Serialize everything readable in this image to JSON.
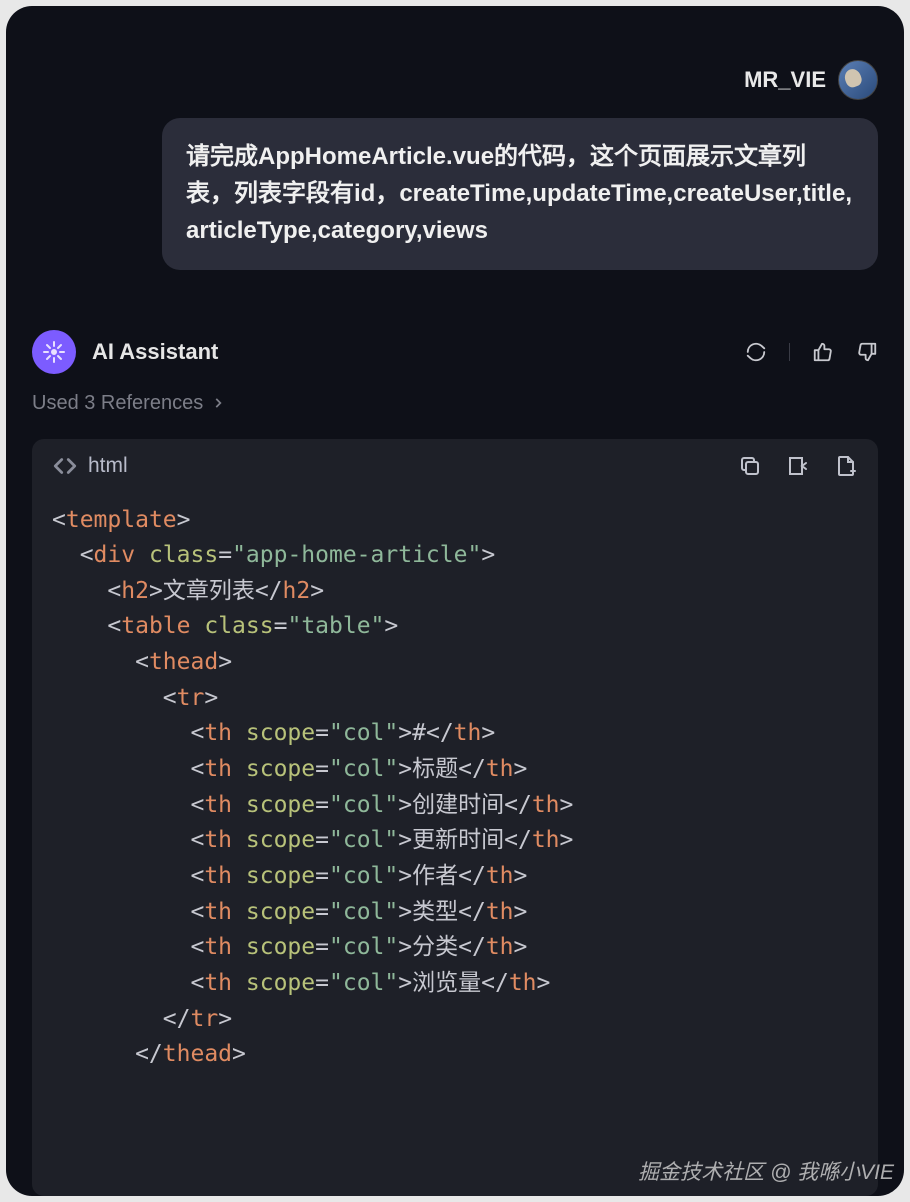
{
  "user": {
    "name": "MR_VIE",
    "message": "请完成AppHomeArticle.vue的代码，这个页面展示文章列表，列表字段有id，createTime,updateTime,createUser,title,articleType,category,views"
  },
  "assistant": {
    "name": "AI Assistant",
    "references_label": "Used 3 References"
  },
  "code": {
    "language": "html",
    "tokens": {
      "t_template": "template",
      "t_div": "div",
      "t_h2": "h2",
      "t_table": "table",
      "t_thead": "thead",
      "t_tr": "tr",
      "t_th": "th",
      "a_class": "class",
      "a_scope": "scope",
      "v_app_home_article": "\"app-home-article\"",
      "v_table": "\"table\"",
      "v_col": "\"col\"",
      "txt_h2": "文章列表",
      "th1": "#",
      "th2": "标题",
      "th3": "创建时间",
      "th4": "更新时间",
      "th5": "作者",
      "th6": "类型",
      "th7": "分类",
      "th8": "浏览量"
    }
  },
  "watermark": "掘金技术社区 @ 我喺小VIE"
}
